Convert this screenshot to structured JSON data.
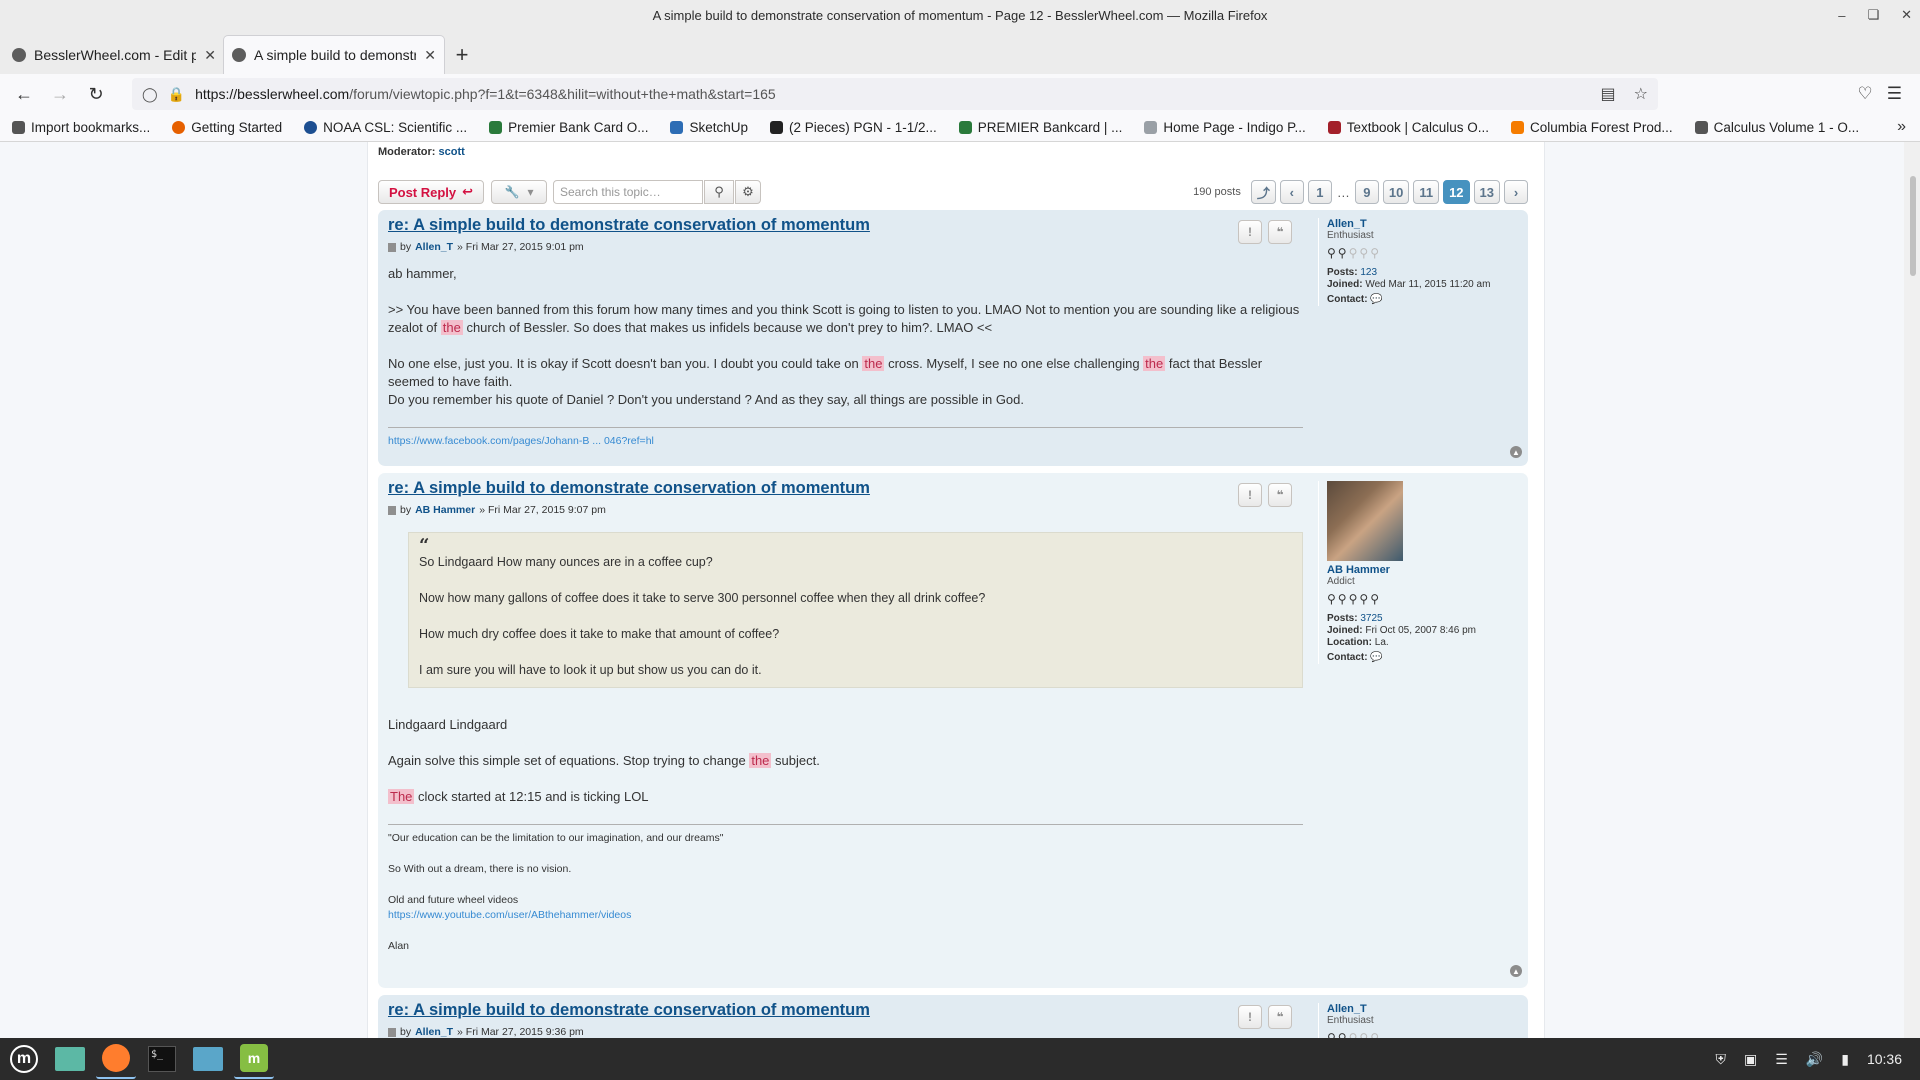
{
  "window": {
    "title": "A simple build to demonstrate conservation of momentum - Page 12 - BesslerWheel.com — Mozilla Firefox"
  },
  "tabs": [
    {
      "label": "BesslerWheel.com - Edit po"
    },
    {
      "label": "A simple build to demonstra"
    }
  ],
  "url": {
    "host": "https://besslerwheel.com",
    "path": "/forum/viewtopic.php?f=1&t=6348&hilit=without+the+math&start=165"
  },
  "bookmarks": [
    {
      "label": "Import bookmarks...",
      "color": "#555555"
    },
    {
      "label": "Getting Started",
      "color": "#e66000"
    },
    {
      "label": "NOAA CSL: Scientific ...",
      "color": "#1d4f91"
    },
    {
      "label": "Premier Bank Card O...",
      "color": "#2a7a3b"
    },
    {
      "label": "SketchUp",
      "color": "#2d6db5"
    },
    {
      "label": "(2 Pieces) PGN - 1-1/2...",
      "color": "#222222"
    },
    {
      "label": "PREMIER Bankcard | ...",
      "color": "#2a7a3b"
    },
    {
      "label": "Home Page - Indigo P...",
      "color": "#9aa0a6"
    },
    {
      "label": "Textbook | Calculus O...",
      "color": "#a3202a"
    },
    {
      "label": "Columbia Forest Prod...",
      "color": "#f57c00"
    },
    {
      "label": "Calculus Volume 1 - O...",
      "color": "#555555"
    }
  ],
  "forum": {
    "moderator_label": "Moderator:",
    "moderator": "scott",
    "post_reply": "Post Reply",
    "search_placeholder": "Search this topic…",
    "post_count": "190 posts",
    "pages": [
      "1",
      "9",
      "10",
      "11",
      "12",
      "13"
    ],
    "current_page": "12",
    "ellipsis": "…"
  },
  "posts": [
    {
      "title": "re: A simple build to demonstrate conservation of momentum",
      "by": "by",
      "author": "Allen_T",
      "date": "» Fri Mar 27, 2015 9:01 pm",
      "greeting": "ab hammer,",
      "p1a": ">> You have been banned from this forum how many times and you think Scott is going to listen to you. LMAO Not to mention you are sounding like a religious zealot of ",
      "hl1": "the",
      "p1b": " church of Bessler. So does that makes us infidels because we don't prey to him?. LMAO <<",
      "p2a": "No one else, just you. It is okay if Scott doesn't ban you. I doubt you could take on ",
      "hl2": "the",
      "p2b": " cross. Myself, I see no one else challenging ",
      "hl3": "the",
      "p2c": " fact that Bessler seemed to have faith.",
      "p2d": "Do you remember his quote of Daniel ? Don't you understand ? And as they say, all things are possible in God.",
      "sig_link": "https://www.facebook.com/pages/Johann-B ... 046?ref=hl",
      "profile": {
        "name": "Allen_T",
        "rank": "Enthusiast",
        "posts_label": "Posts:",
        "posts": "123",
        "joined_label": "Joined:",
        "joined": "Wed Mar 11, 2015 11:20 am",
        "contact_label": "Contact:"
      }
    },
    {
      "title": "re: A simple build to demonstrate conservation of momentum",
      "by": "by",
      "author": "AB Hammer",
      "date": "» Fri Mar 27, 2015 9:07 pm",
      "quote": [
        "So Lindgaard How many ounces are in a coffee cup?",
        "Now how many gallons of coffee does it take to serve 300 personnel coffee when they all drink coffee?",
        "How much dry coffee does it take to make that amount of coffee?",
        "I am sure you will have to look it up but show us you can do it."
      ],
      "p1": "Lindgaard Lindgaard",
      "p2a": "Again solve this simple set of equations. Stop trying to change ",
      "hl1": "the",
      "p2b": " subject.",
      "hl2": "The",
      "p3b": " clock started at 12:15 and is ticking LOL",
      "sig1": "\"Our education can be the limitation to our imagination, and our dreams\"",
      "sig2": "So With out a dream, there is no vision.",
      "sig3": "Old and future wheel videos",
      "sig_link": "https://www.youtube.com/user/ABthehammer/videos",
      "sig4": "Alan",
      "profile": {
        "name": "AB Hammer",
        "rank": "Addict",
        "posts_label": "Posts:",
        "posts": "3725",
        "joined_label": "Joined:",
        "joined": "Fri Oct 05, 2007 8:46 pm",
        "location_label": "Location:",
        "location": "La.",
        "contact_label": "Contact:"
      }
    },
    {
      "title": "re: A simple build to demonstrate conservation of momentum",
      "by": "by",
      "author": "Allen_T",
      "date": "» Fri Mar 27, 2015 9:36 pm",
      "profile": {
        "name": "Allen_T",
        "rank": "Enthusiast"
      }
    }
  ],
  "taskbar": {
    "clock": "10:36"
  }
}
